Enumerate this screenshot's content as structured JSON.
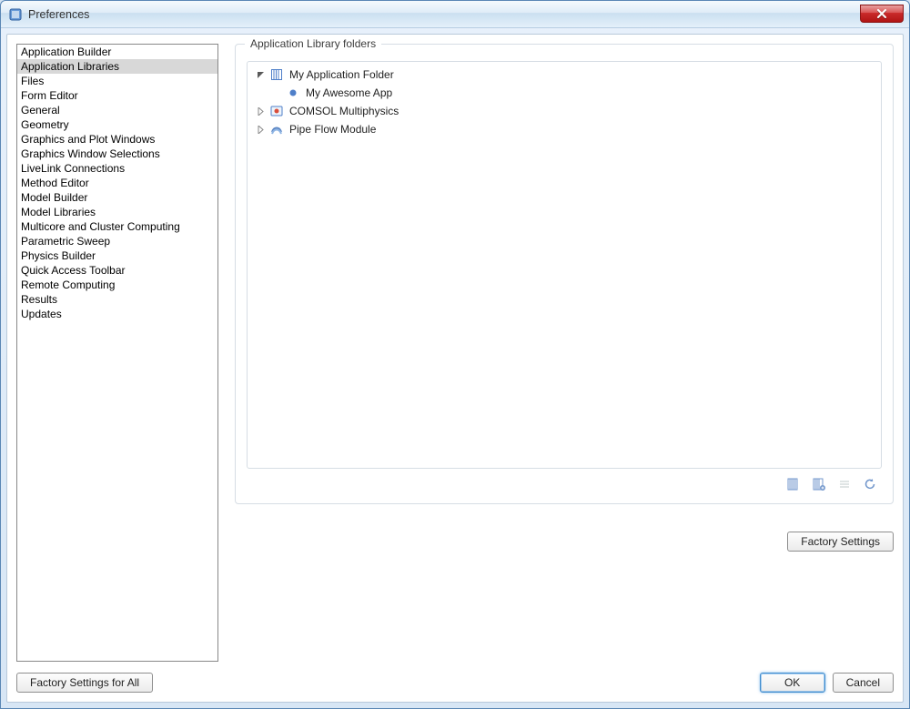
{
  "window": {
    "title": "Preferences"
  },
  "sidebar": {
    "items": [
      "Application Builder",
      "Application Libraries",
      "Files",
      "Form Editor",
      "General",
      "Geometry",
      "Graphics and Plot Windows",
      "Graphics Window Selections",
      "LiveLink Connections",
      "Method Editor",
      "Model Builder",
      "Model Libraries",
      "Multicore and Cluster Computing",
      "Parametric Sweep",
      "Physics Builder",
      "Quick Access Toolbar",
      "Remote Computing",
      "Results",
      "Updates"
    ],
    "selectedIndex": 1
  },
  "panel": {
    "groupTitle": "Application Library folders",
    "tree": {
      "nodes": [
        {
          "label": "My Application Folder",
          "depth": 0,
          "expanded": true,
          "icon": "library-icon"
        },
        {
          "label": "My Awesome App",
          "depth": 1,
          "expanded": null,
          "icon": "app-dot-icon"
        },
        {
          "label": "COMSOL Multiphysics",
          "depth": 0,
          "expanded": false,
          "icon": "comsol-icon"
        },
        {
          "label": "Pipe Flow Module",
          "depth": 0,
          "expanded": false,
          "icon": "pipe-icon"
        }
      ]
    },
    "toolbar": {
      "addFolder": "Add user application library",
      "addDir": "Set COMSOL application library root",
      "remove": "Remove selected",
      "refresh": "Refresh"
    },
    "factorySettings": "Factory Settings"
  },
  "footer": {
    "factoryAll": "Factory Settings for All",
    "ok": "OK",
    "cancel": "Cancel"
  },
  "colors": {
    "accent": "#3f8bcd",
    "iconBlue": "#4f7fc9"
  }
}
